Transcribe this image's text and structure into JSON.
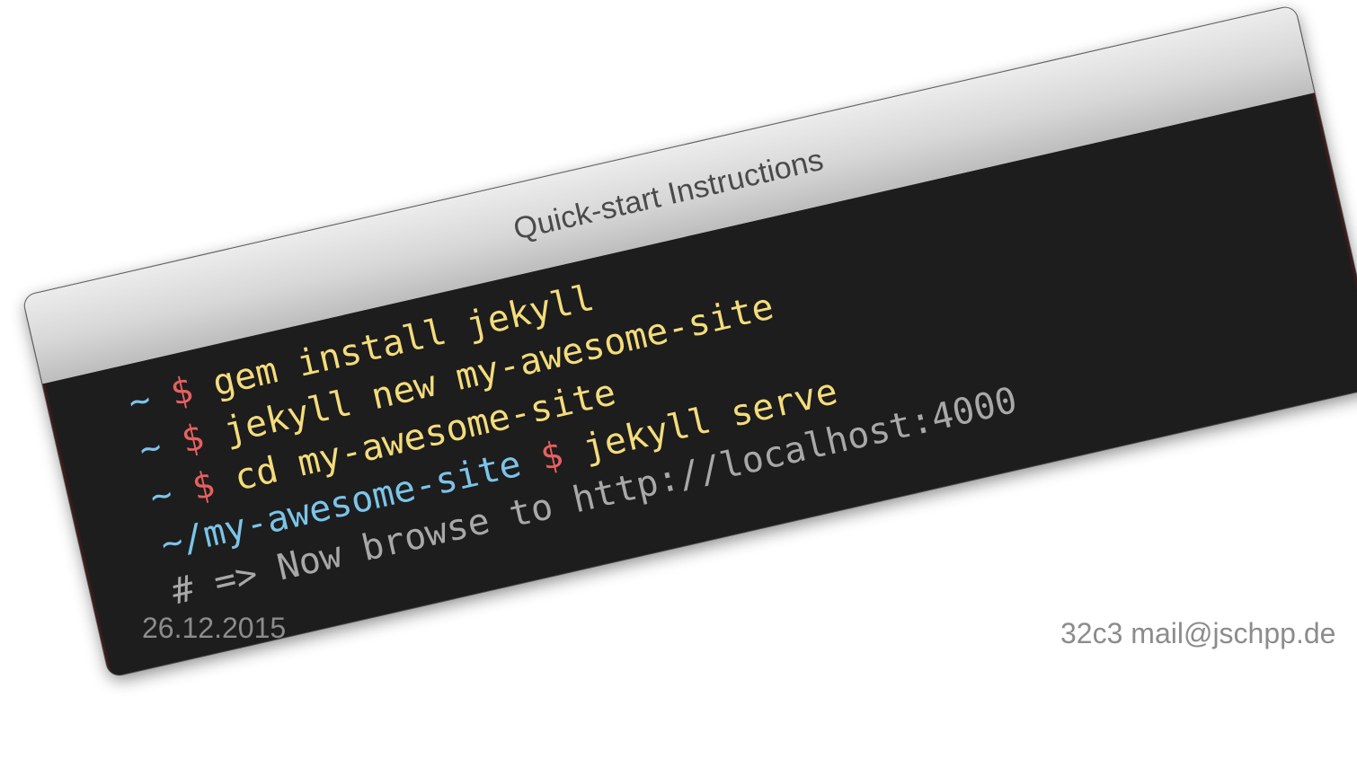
{
  "window": {
    "title": "Quick-start Instructions"
  },
  "terminal": {
    "lines": [
      {
        "prompt_path": "~",
        "prompt_symbol": "$",
        "command": "gem install jekyll"
      },
      {
        "prompt_path": "~",
        "prompt_symbol": "$",
        "command": "jekyll new my-awesome-site"
      },
      {
        "prompt_path": "~",
        "prompt_symbol": "$",
        "command": "cd my-awesome-site"
      },
      {
        "prompt_path": "~/my-awesome-site",
        "prompt_symbol": "$",
        "command": "jekyll serve"
      }
    ],
    "comment": "# => Now browse to http://localhost:4000"
  },
  "footer": {
    "date": "26.12.2015",
    "author": "32c3 mail@jschpp.de"
  },
  "colors": {
    "prompt_path": "#7cc4e8",
    "prompt_symbol": "#e8605f",
    "command": "#f4dc7b",
    "comment": "#a8a8a8",
    "terminal_background": "#1d1d1e",
    "title_bar": "#d7d7d7"
  }
}
